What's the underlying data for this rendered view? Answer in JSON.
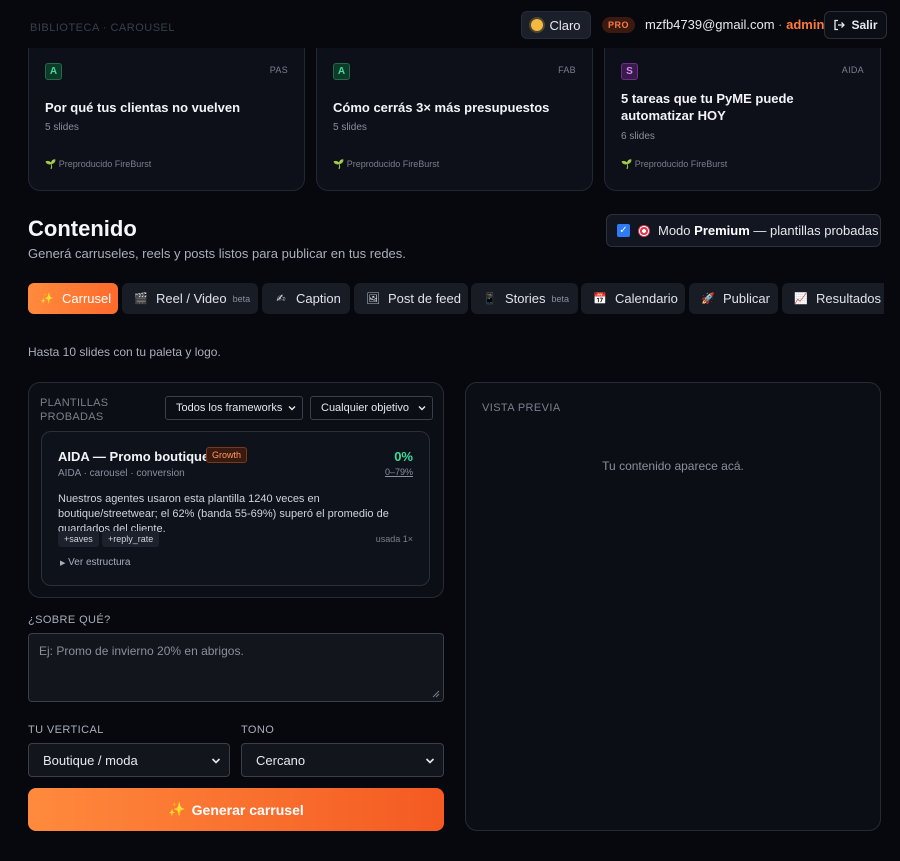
{
  "header": {
    "breadcrumb": "BIBLIOTECA · CAROUSEL",
    "theme_label": "Claro",
    "pro_badge": "PRO",
    "user_email": "mzfb4739@gmail.com",
    "separator": "·",
    "user_role": "admin",
    "logout_label": "Salir"
  },
  "library_cards": [
    {
      "badge": "A",
      "framework": "PAS",
      "title": "Por qué tus clientas no vuelven",
      "slides": "5 slides",
      "producer": "Preproducido FireBurst"
    },
    {
      "badge": "A",
      "framework": "FAB",
      "title": "Cómo cerrás 3× más presupuestos",
      "slides": "5 slides",
      "producer": "Preproducido FireBurst"
    },
    {
      "badge": "S",
      "framework": "AIDA",
      "title": "5 tareas que tu PyME puede automatizar HOY",
      "slides": "6 slides",
      "producer": "Preproducido FireBurst"
    }
  ],
  "content": {
    "title": "Contenido",
    "subtitle": "Generá carruseles, reels y posts listos para publicar en tus redes.",
    "premium_prefix": "Modo",
    "premium_bold": "Premium",
    "premium_suffix": "— plantillas probadas",
    "premium_checked": true
  },
  "tabs": [
    {
      "label": "Carrusel",
      "icon": "carousel-icon",
      "active": true
    },
    {
      "label": "Reel / Video",
      "icon": "film-icon",
      "beta": "beta"
    },
    {
      "label": "Caption",
      "icon": "writing-hand-icon"
    },
    {
      "label": "Post de feed",
      "icon": "picture-icon"
    },
    {
      "label": "Stories",
      "icon": "phone-icon",
      "beta": "beta"
    },
    {
      "label": "Calendario",
      "icon": "calendar-icon"
    },
    {
      "label": "Publicar",
      "icon": "rocket-icon"
    },
    {
      "label": "Resultados",
      "icon": "chart-icon"
    }
  ],
  "hint": "Hasta 10 slides con tu paleta y logo.",
  "templates": {
    "label_line1": "PLANTILLAS",
    "label_line2": "PROBADAS",
    "framework_filter": "Todos los frameworks",
    "objective_filter": "Cualquier objetivo",
    "card": {
      "name": "AIDA — Promo boutique",
      "tier": "Growth",
      "meta": "AIDA · carousel · conversion",
      "percent": "0%",
      "band": "0–79%",
      "description": "Nuestros agentes usaron esta plantilla 1240 veces en boutique/streetwear; el 62% (banda 55-69%) superó el promedio de guardados del cliente.",
      "tags": [
        "+saves",
        "+reply_rate"
      ],
      "used": "usada 1×",
      "structure_label": "Ver estructura"
    }
  },
  "form": {
    "topic_label": "¿SOBRE QUÉ?",
    "topic_placeholder": "Ej: Promo de invierno 20% en abrigos.",
    "vertical_label": "TU VERTICAL",
    "vertical_value": "Boutique / moda",
    "tone_label": "TONO",
    "tone_value": "Cercano",
    "generate_label": "Generar carrusel"
  },
  "preview": {
    "label": "VISTA PREVIA",
    "empty": "Tu contenido aparece acá."
  },
  "colors": {
    "accent": "#ff7a3d",
    "success": "#3ddc97",
    "background": "#06080d"
  }
}
